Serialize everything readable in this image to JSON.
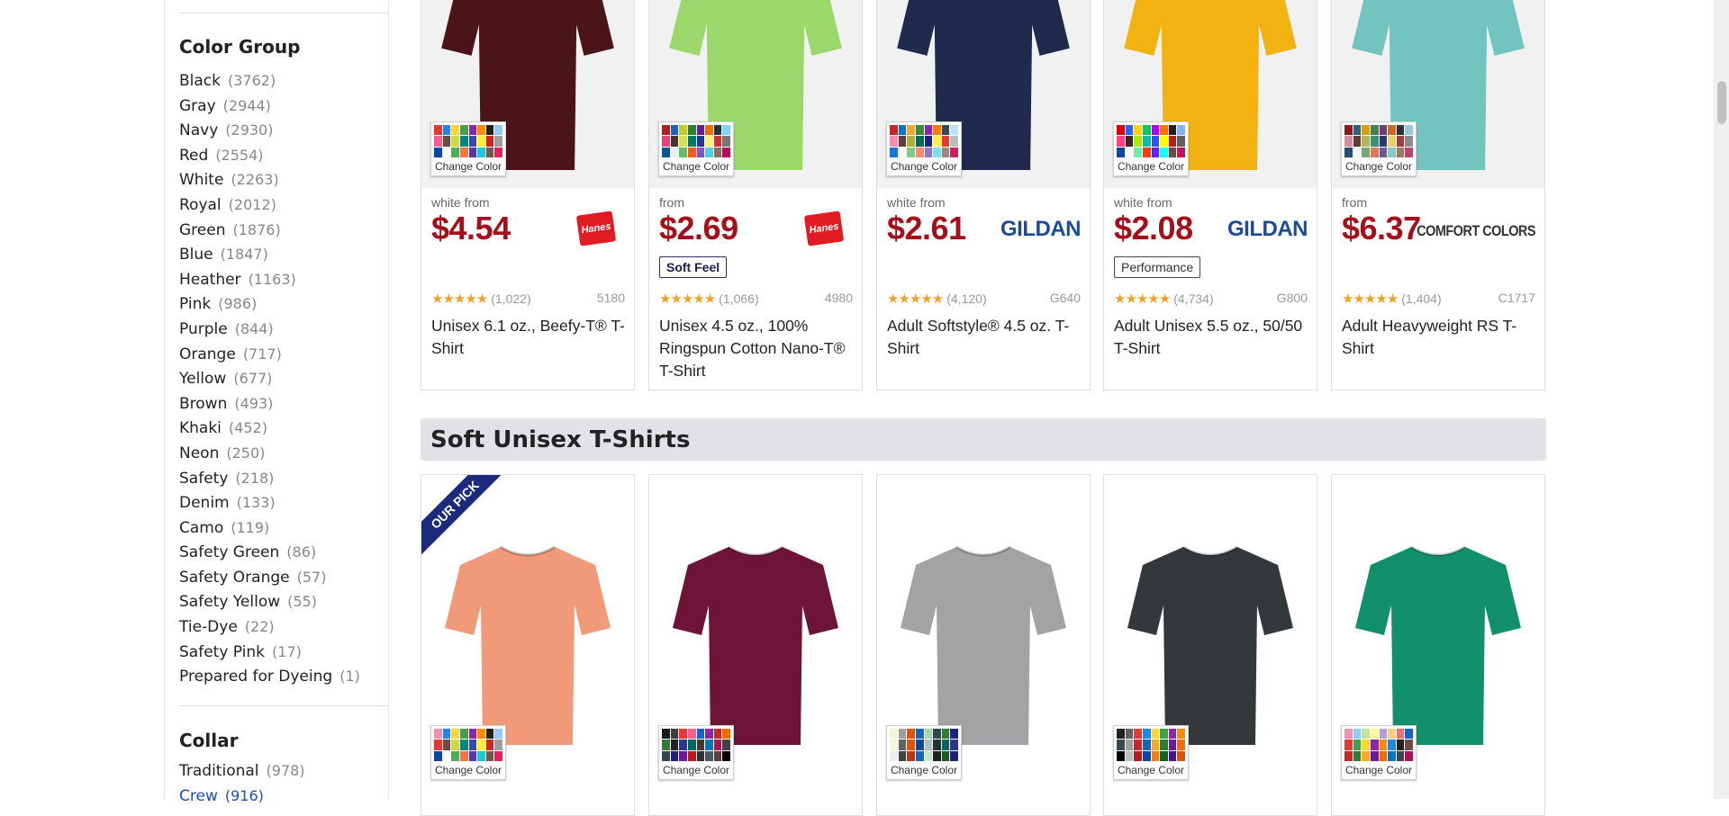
{
  "filters": {
    "color_group": {
      "heading": "Color Group",
      "items": [
        {
          "label": "Black",
          "count": "(3762)"
        },
        {
          "label": "Gray",
          "count": "(2944)"
        },
        {
          "label": "Navy",
          "count": "(2930)"
        },
        {
          "label": "Red",
          "count": "(2554)"
        },
        {
          "label": "White",
          "count": "(2263)"
        },
        {
          "label": "Royal",
          "count": "(2012)"
        },
        {
          "label": "Green",
          "count": "(1876)"
        },
        {
          "label": "Blue",
          "count": "(1847)"
        },
        {
          "label": "Heather",
          "count": "(1163)"
        },
        {
          "label": "Pink",
          "count": "(986)"
        },
        {
          "label": "Purple",
          "count": "(844)"
        },
        {
          "label": "Orange",
          "count": "(717)"
        },
        {
          "label": "Yellow",
          "count": "(677)"
        },
        {
          "label": "Brown",
          "count": "(493)"
        },
        {
          "label": "Khaki",
          "count": "(452)"
        },
        {
          "label": "Neon",
          "count": "(250)"
        },
        {
          "label": "Safety",
          "count": "(218)"
        },
        {
          "label": "Denim",
          "count": "(133)"
        },
        {
          "label": "Camo",
          "count": "(119)"
        },
        {
          "label": "Safety Green",
          "count": "(86)"
        },
        {
          "label": "Safety Orange",
          "count": "(57)"
        },
        {
          "label": "Safety Yellow",
          "count": "(55)"
        },
        {
          "label": "Tie-Dye",
          "count": "(22)"
        },
        {
          "label": "Safety Pink",
          "count": "(17)"
        },
        {
          "label": "Prepared for Dyeing",
          "count": "(1)"
        }
      ]
    },
    "collar": {
      "heading": "Collar",
      "items": [
        {
          "label": "Traditional",
          "count": "(978)"
        },
        {
          "label": "Crew",
          "count": "(916)"
        }
      ]
    }
  },
  "change_color_label": "Change Color",
  "top_products": [
    {
      "price_from": "white from",
      "price": "$4.54",
      "brand": "Hanes",
      "tag": "",
      "stars": "★★★★★",
      "rating_count": "(1,022)",
      "sku": "5180",
      "title": "Unisex 6.1 oz., Beefy-T® T-Shirt",
      "shirt_color": "#4a1418"
    },
    {
      "price_from": "from",
      "price": "$2.69",
      "brand": "Hanes",
      "tag": "Soft Feel",
      "stars": "★★★★★",
      "rating_count": "(1,066)",
      "sku": "4980",
      "title": "Unisex 4.5 oz., 100% Ringspun Cotton Nano-T® T-Shirt",
      "shirt_color": "#9bd76a"
    },
    {
      "price_from": "white from",
      "price": "$2.61",
      "brand": "GILDAN",
      "tag": "",
      "stars": "★★★★★",
      "rating_count": "(4,120)",
      "sku": "G640",
      "title": "Adult Softstyle® 4.5 oz. T-Shirt",
      "shirt_color": "#1f2a4c"
    },
    {
      "price_from": "white from",
      "price": "$2.08",
      "brand": "GILDAN",
      "tag": "Performance",
      "stars": "★★★★★",
      "rating_count": "(4,734)",
      "sku": "G800",
      "title": "Adult Unisex 5.5 oz., 50/50 T-Shirt",
      "shirt_color": "#f2b211"
    },
    {
      "price_from": "from",
      "price": "$6.37",
      "brand": "COMFORT COLORS",
      "tag": "",
      "stars": "★★★★★",
      "rating_count": "(1,404)",
      "sku": "C1717",
      "title": "Adult Heavyweight RS T-Shirt",
      "shirt_color": "#72c4c0"
    }
  ],
  "section": {
    "title": "Soft Unisex T-Shirts",
    "ribbon": "OUR PICK",
    "products": [
      {
        "shirt_color": "#f09a7a"
      },
      {
        "shirt_color": "#6e1437"
      },
      {
        "shirt_color": "#a3a3a5"
      },
      {
        "shirt_color": "#33383a"
      },
      {
        "shirt_color": "#12906a"
      }
    ]
  },
  "swatch_palettes": [
    [
      "#e53935",
      "#1e88e5",
      "#fdd835",
      "#43a047",
      "#8e24aa",
      "#fb8c00",
      "#212121",
      "#90caf9",
      "#f06292",
      "#6d4c41",
      "#cddc39",
      "#00897b",
      "#3949ab",
      "#ffeb3b",
      "#c62828",
      "#9e9e9e",
      "#0d47a1",
      "#ffffff",
      "#4caf50",
      "#ff7043",
      "#5e35b1",
      "#26c6da",
      "#795548",
      "#e91e63"
    ],
    [
      "#b71c1c",
      "#1565c0",
      "#c0ca33",
      "#2e7d32",
      "#6a1b9a",
      "#ef6c00",
      "#263238",
      "#81d4fa",
      "#ec407a",
      "#4e342e",
      "#d4e157",
      "#00796b",
      "#283593",
      "#fff176",
      "#d32f2f",
      "#757575",
      "#01579b",
      "#eeeeee",
      "#66bb6a",
      "#ff5722",
      "#7e57c2",
      "#4dd0e1",
      "#8d6e63",
      "#ad1457"
    ],
    [
      "#c62828",
      "#0277bd",
      "#f9a825",
      "#388e3c",
      "#8e24aa",
      "#f57c00",
      "#37474f",
      "#b3e5fc",
      "#f48fb1",
      "#5d4037",
      "#afb42b",
      "#00695c",
      "#1a237e",
      "#ffee58",
      "#e53935",
      "#bdbdbd",
      "#1976d2",
      "#fafafa",
      "#81c784",
      "#ff8a65",
      "#9575cd",
      "#80deea",
      "#a1887f",
      "#d81b60"
    ],
    [
      "#d50000",
      "#2962ff",
      "#ffd600",
      "#00c853",
      "#aa00ff",
      "#ff6d00",
      "#212121",
      "#82b1ff",
      "#ff4081",
      "#3e2723",
      "#aeea00",
      "#00bfa5",
      "#304ffe",
      "#ffff00",
      "#b71c1c",
      "#616161",
      "#0d47a1",
      "#ffffff",
      "#69f0ae",
      "#ff3d00",
      "#651fff",
      "#18ffff",
      "#6d4c41",
      "#c51162"
    ],
    [
      "#8b1a1a",
      "#375a7f",
      "#d4a017",
      "#4a7c59",
      "#6b3f69",
      "#d2691e",
      "#2f2f2f",
      "#9ac7d8",
      "#d98c9f",
      "#5c4033",
      "#b5b35c",
      "#3e8e7e",
      "#2b3a67",
      "#e8d06a",
      "#a23b3b",
      "#8a8a8a",
      "#1f4e79",
      "#f5f5f5",
      "#7aa874",
      "#e07a5f",
      "#6a5d94",
      "#88c9c4",
      "#9c7a5b",
      "#b5456b"
    ]
  ],
  "swatch_palettes_bottom": [
    [
      "#f48fb1",
      "#1e88e5",
      "#fdd835",
      "#43a047",
      "#8e24aa",
      "#fb8c00",
      "#212121",
      "#90caf9",
      "#e53935",
      "#6d4c41",
      "#cddc39",
      "#00897b",
      "#3949ab",
      "#ffeb3b",
      "#c62828",
      "#9e9e9e",
      "#0d47a1",
      "#ffffff",
      "#4caf50",
      "#ff7043",
      "#5e35b1",
      "#26c6da",
      "#795548",
      "#e91e63"
    ],
    [
      "#1b1b1b",
      "#3d3d3d",
      "#e53935",
      "#f06292",
      "#1565c0",
      "#8e24aa",
      "#c62828",
      "#ef6c00",
      "#2e7d32",
      "#212121",
      "#283593",
      "#00695c",
      "#4e342e",
      "#0277bd",
      "#ad1457",
      "#424242",
      "#37474f",
      "#1a237e",
      "#6a1b9a",
      "#b71c1c",
      "#263238",
      "#455a64",
      "#5d4037",
      "#000000"
    ],
    [
      "#f5f5dc",
      "#9e9e9e",
      "#e65100",
      "#1565c0",
      "#a5d6a7",
      "#37474f",
      "#2e7d32",
      "#1a237e",
      "#f5f5dc",
      "#616161",
      "#e65100",
      "#0d47a1",
      "#b0bec5",
      "#263238",
      "#00695c",
      "#283593",
      "#eeeeee",
      "#424242",
      "#bf360c",
      "#1565c0",
      "#c8e6c9",
      "#212121",
      "#1b5e20",
      "#1a237e"
    ],
    [
      "#212121",
      "#616161",
      "#e53935",
      "#1e88e5",
      "#fdd835",
      "#43a047",
      "#8e24aa",
      "#fb8c00",
      "#37474f",
      "#9e9e9e",
      "#c62828",
      "#1565c0",
      "#f9a825",
      "#2e7d32",
      "#6a1b9a",
      "#ef6c00",
      "#000000",
      "#bdbdbd",
      "#b71c1c",
      "#0d47a1",
      "#f57f17",
      "#1b5e20",
      "#4a148c",
      "#e65100"
    ],
    [
      "#f48fb1",
      "#90caf9",
      "#c5e1a5",
      "#fff59d",
      "#b39ddb",
      "#ffcc80",
      "#e57373",
      "#1565c0",
      "#e53935",
      "#43a047",
      "#fdd835",
      "#8e24aa",
      "#fb8c00",
      "#1e88e5",
      "#212121",
      "#6d4c41",
      "#c62828",
      "#2e7d32",
      "#f9a825",
      "#6a1b9a",
      "#ef6c00",
      "#0277bd",
      "#37474f",
      "#ad1457"
    ]
  ]
}
